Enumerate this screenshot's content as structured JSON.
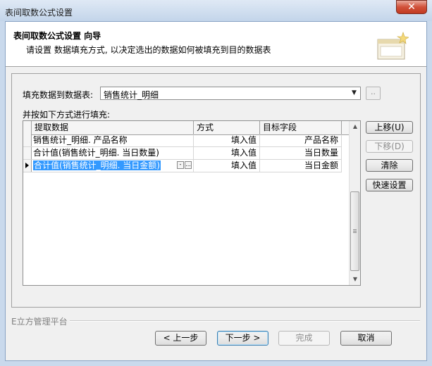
{
  "window": {
    "title": "表间取数公式设置",
    "close_glyph": "✕"
  },
  "header": {
    "title": "表间取数公式设置  向导",
    "subtitle": "请设置  数据填充方式, 以决定选出的数据如何被填充到目的数据表"
  },
  "fill_target": {
    "label": "填充数据到数据表:",
    "value": "销售统计_明细",
    "dots_label": "..",
    "arrow_glyph": "▼"
  },
  "fill_mode_label": "并按如下方式进行填充:",
  "grid": {
    "columns": [
      "提取数据",
      "方式",
      "目标字段"
    ],
    "rows": [
      {
        "source": "销售统计_明细. 产品名称",
        "mode": "填入值",
        "target": "产品名称"
      },
      {
        "source": "合计值(销售统计_明细. 当日数量)",
        "mode": "填入值",
        "target": "当日数量"
      },
      {
        "source": "合计值(销售统计_明细. 当日金额)",
        "mode": "填入值",
        "target": "当日金额",
        "selected": true
      }
    ],
    "editor_buttons": {
      "minus": "-",
      "dots": "..."
    }
  },
  "side_buttons": {
    "move_up": "上移(U)",
    "move_down": "下移(D)",
    "clear": "清除",
    "quick_set": "快速设置"
  },
  "footer": {
    "platform": "E立方管理平台",
    "prev": "< 上一步",
    "next": "下一步 >",
    "finish": "完成",
    "cancel": "取消"
  },
  "colors": {
    "selection": "#3399ff",
    "title_bar": "#c3d5ea",
    "close_button": "#d1513a"
  }
}
